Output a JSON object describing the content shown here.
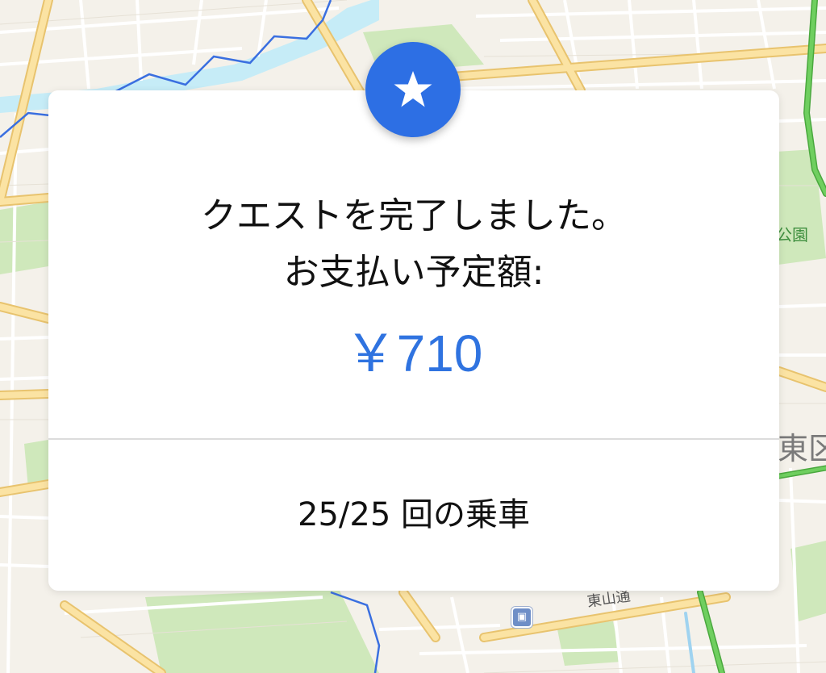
{
  "map": {
    "labels": {
      "park": "公園",
      "district": "東区",
      "road": "東山通"
    },
    "colors": {
      "background": "#f4f1ea",
      "major_road": "#fbe3a3",
      "major_road_border": "#e8c36e",
      "minor_road": "#ffffff",
      "river": "#c6ecf7",
      "boundary": "#3a6fe0",
      "park": "#cfe8bb",
      "highway": "#5cbf4f"
    }
  },
  "quest_card": {
    "badge_icon": "star-icon",
    "completion_message": "クエストを完了しました。",
    "payment_label": "お支払い予定額:",
    "payment_amount": "￥710",
    "ride_progress": "25/25 回の乗車",
    "colors": {
      "accent": "#2d6fe4",
      "amount_text": "#2f73e0",
      "card_background": "#ffffff"
    }
  }
}
